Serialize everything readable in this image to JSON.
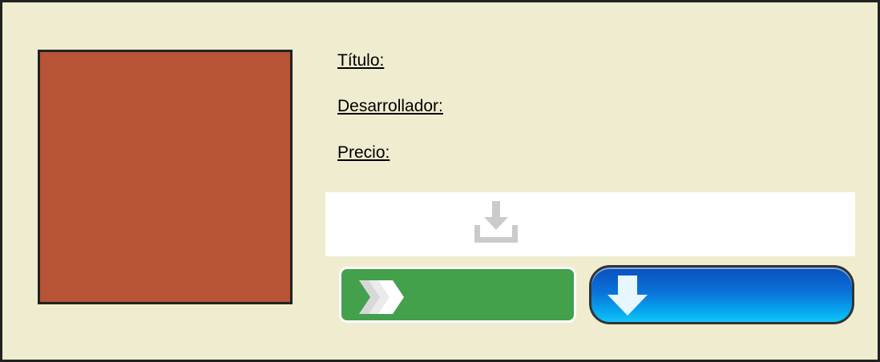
{
  "product": {
    "cover_color": "#b75336",
    "title_label": "Título:",
    "developer_label": "Desarrollador:",
    "price_label": "Precio:"
  },
  "download_area": {
    "icon": "download-tray-icon"
  },
  "buttons": {
    "proceed": {
      "icon": "chevrons-right-icon",
      "color": "#43a04b"
    },
    "download": {
      "icon": "arrow-down-icon",
      "color": "#0a73d8"
    }
  }
}
